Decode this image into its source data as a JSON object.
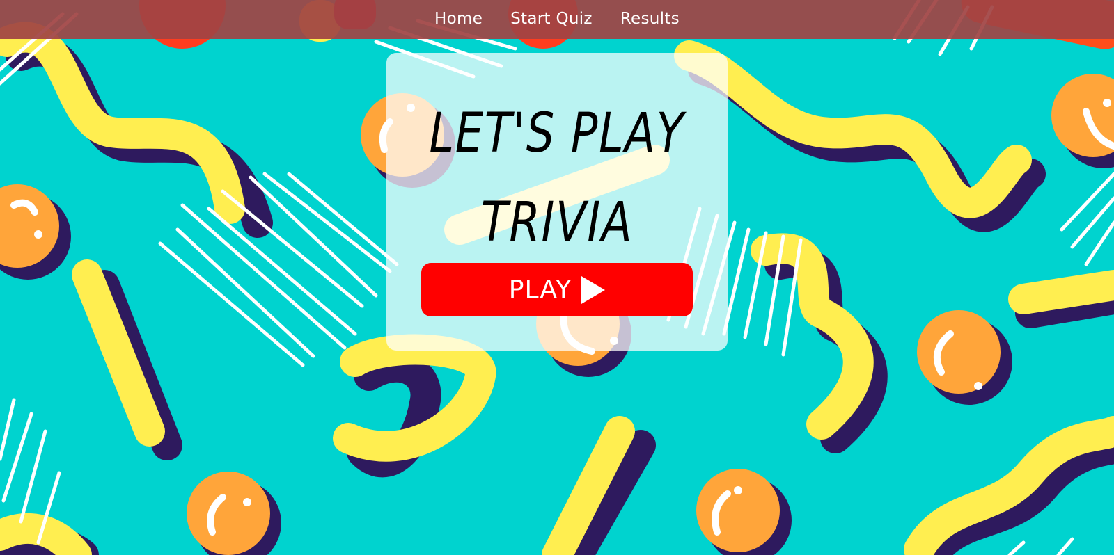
{
  "nav": {
    "links": [
      {
        "label": "Home"
      },
      {
        "label": "Start Quiz"
      },
      {
        "label": "Results"
      }
    ]
  },
  "hero": {
    "title_line1": "LET'S PLAY",
    "title_line2": "TRIVIA",
    "play_label": "PLAY",
    "play_icon": "play-triangle-icon"
  },
  "colors": {
    "background": "#00d3cf",
    "navbar": "#a04444",
    "play_button": "#ff0000",
    "squiggle_yellow": "#ffee50",
    "squiggle_shadow": "#2e1a5e",
    "ball_orange": "#ffa53a",
    "ball_red": "#ff3d1f"
  }
}
